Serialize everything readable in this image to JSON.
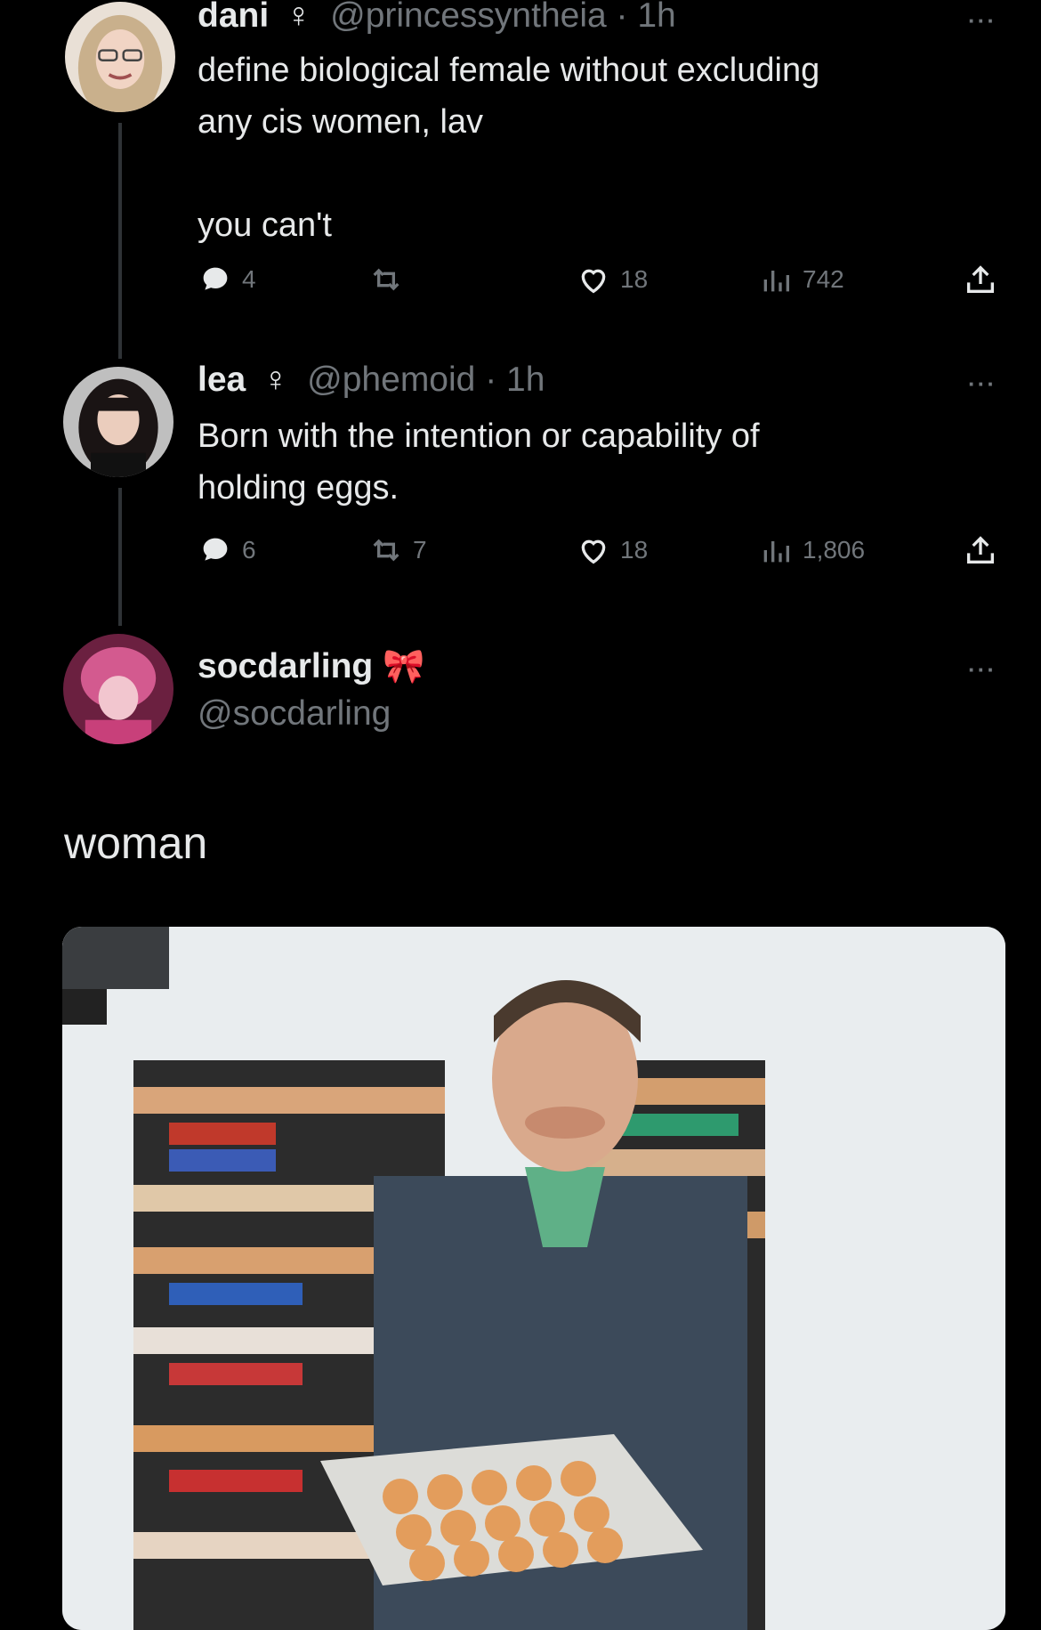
{
  "tweets": [
    {
      "name": "dani",
      "gender_symbol": "♀",
      "handle": "@princessyntheia",
      "time": "· 1h",
      "text_lines": [
        "define biological female without excluding",
        "any cis women, lav",
        "",
        "you can't"
      ],
      "replies": "4",
      "retweets": "",
      "likes": "18",
      "views": "742"
    },
    {
      "name": "lea",
      "gender_symbol": "♀",
      "handle": "@phemoid",
      "time": "· 1h",
      "text_lines": [
        "Born with the intention or capability of",
        "holding eggs."
      ],
      "replies": "6",
      "retweets": "7",
      "likes": "18",
      "views": "1,806"
    }
  ],
  "quote_author": {
    "name": "socdarling",
    "badge": "🎀",
    "handle": "@socdarling"
  },
  "quote_text": "woman",
  "more_icon": "···",
  "icons": [
    "reply-icon",
    "retweet-icon",
    "like-icon",
    "views-icon",
    "share-icon",
    "more-icon"
  ],
  "colors": {
    "background": "#000000",
    "text": "#e7e9ea",
    "muted": "#71767b"
  }
}
